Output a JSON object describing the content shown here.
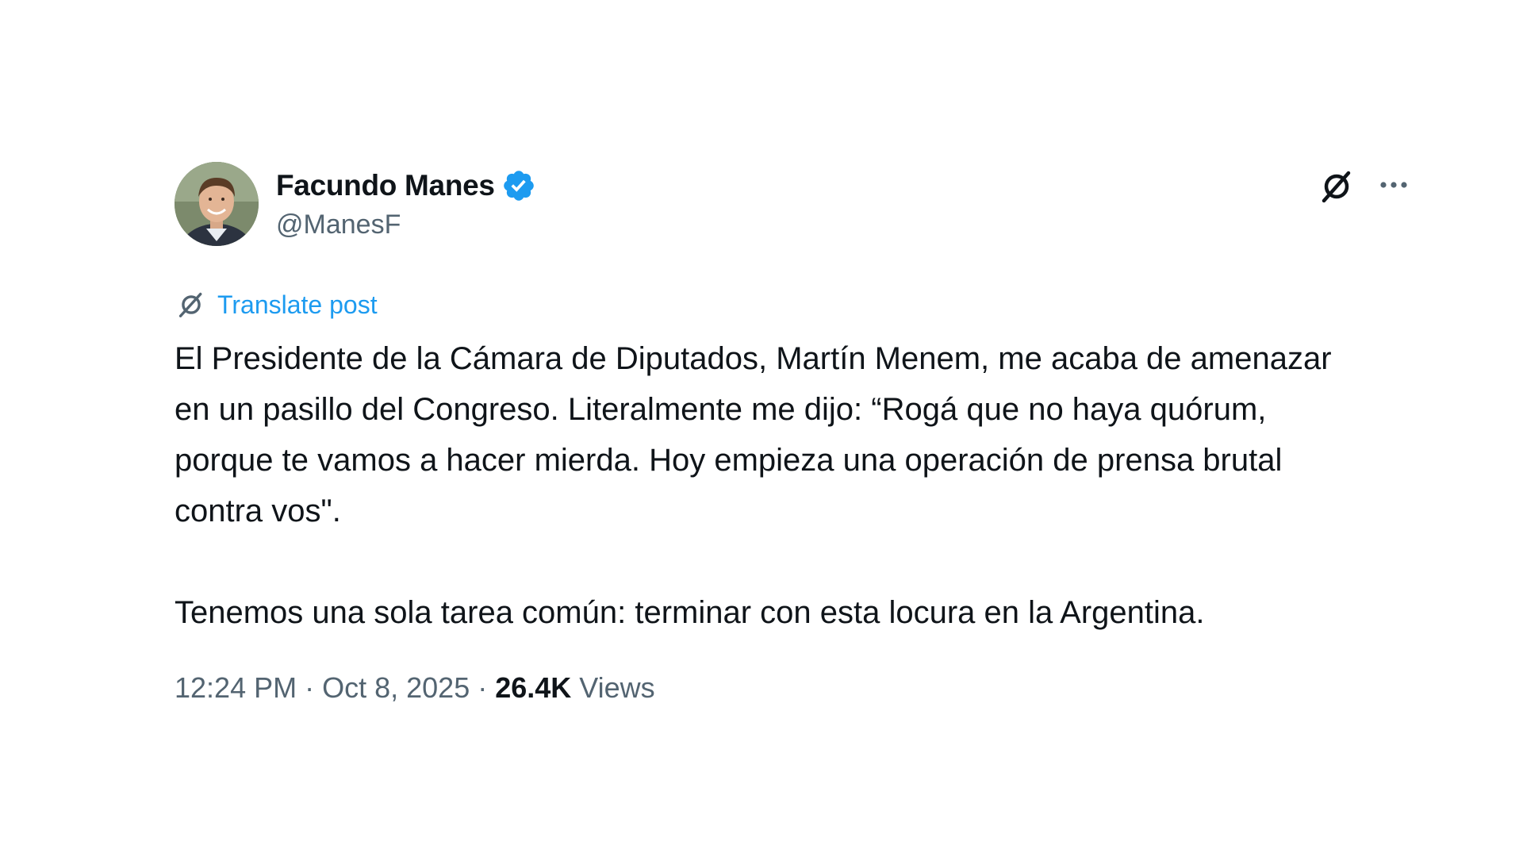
{
  "author": {
    "display_name": "Facundo Manes",
    "handle": "@ManesF",
    "verified": true,
    "verified_color": "#1d9bf0",
    "avatar_icon": "profile-photo"
  },
  "actions": {
    "grok_icon": "grok-icon",
    "more_icon": "more-icon"
  },
  "translate": {
    "label": "Translate post",
    "color": "#1d9bf0"
  },
  "post": {
    "text": "El Presidente de la Cámara de Diputados, Martín Menem, me acaba de amenazar en un pasillo del Congreso. Literalmente me dijo: “Rogá que no haya quórum, porque te vamos a hacer mierda. Hoy empieza una operación de prensa brutal contra vos\".\n\nTenemos una sola tarea común: terminar con esta locura en la Argentina."
  },
  "meta": {
    "time": "12:24 PM",
    "separator": "·",
    "date": "Oct 8, 2025",
    "views_count": "26.4K",
    "views_label": "Views"
  }
}
